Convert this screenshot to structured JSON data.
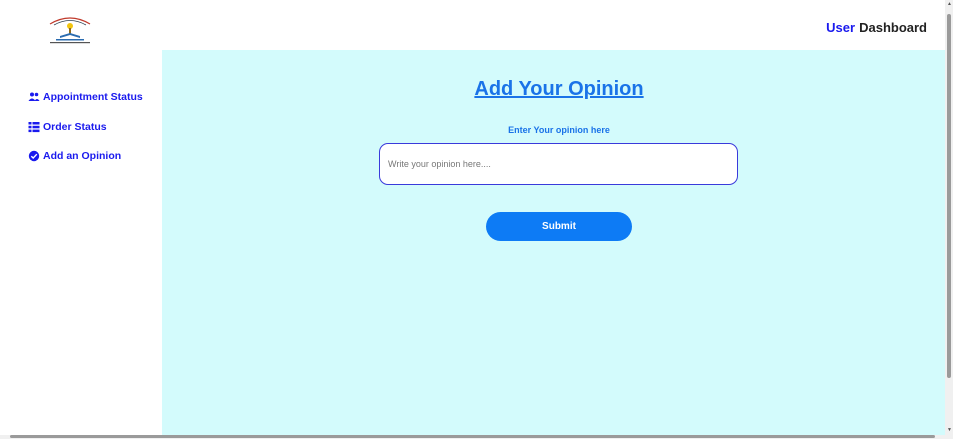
{
  "header": {
    "user_label": "User",
    "dashboard_label": "Dashboard",
    "logo_icon": "institution-logo"
  },
  "sidebar": {
    "items": [
      {
        "label": "Appointment Status",
        "icon": "users-icon"
      },
      {
        "label": "Order Status",
        "icon": "list-icon"
      },
      {
        "label": "Add an Opinion",
        "icon": "check-circle-icon"
      }
    ]
  },
  "main": {
    "title": "Add Your Opinion",
    "subtitle": "Enter Your opinion here",
    "input_placeholder": "Write your opinion here....",
    "input_value": "",
    "submit_label": "Submit"
  },
  "colors": {
    "accent": "#1a1aee",
    "link_blue": "#1a73e8",
    "main_bg": "#d3fbfc",
    "button": "#0d7bf5"
  }
}
